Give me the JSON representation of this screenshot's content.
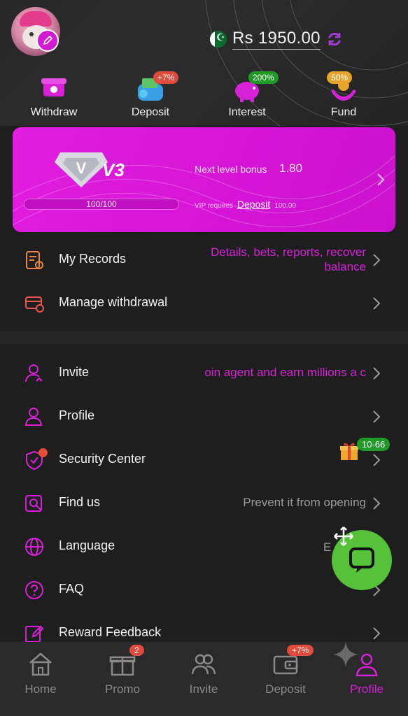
{
  "header": {
    "balance": "Rs 1950.00"
  },
  "quick_actions": [
    {
      "label": "Withdraw",
      "badge": ""
    },
    {
      "label": "Deposit",
      "badge": "+7%"
    },
    {
      "label": "Interest",
      "badge": "200%"
    },
    {
      "label": "Fund",
      "badge": "50%"
    }
  ],
  "vip": {
    "level": "V3",
    "progress_text": "100/100",
    "progress_fraction": 1.0,
    "next_level_label": "Next level bonus",
    "next_level_value": "1.80",
    "requires_label": "VIP requires",
    "requires_link": "Deposit",
    "requires_value": "100.00"
  },
  "records": [
    {
      "label": "My Records",
      "detail_line1": "Details, bets, reports, recover",
      "detail_line2": "balance"
    },
    {
      "label": "Manage withdrawal",
      "detail": ""
    }
  ],
  "menu": [
    {
      "label": "Invite",
      "detail": "oin agent and earn millions a c"
    },
    {
      "label": "Profile",
      "detail": ""
    },
    {
      "label": "Security Center",
      "detail": "",
      "badge": "10-66"
    },
    {
      "label": "Find us",
      "detail": "Prevent it from opening"
    },
    {
      "label": "Language",
      "detail": "E"
    },
    {
      "label": "FAQ",
      "detail": ""
    },
    {
      "label": "Reward Feedback",
      "detail": ""
    }
  ],
  "tabbar": [
    {
      "label": "Home",
      "badge": ""
    },
    {
      "label": "Promo",
      "badge": "2"
    },
    {
      "label": "Invite",
      "badge": ""
    },
    {
      "label": "Deposit",
      "badge": "+7%"
    },
    {
      "label": "Profile",
      "badge": "",
      "active": true
    }
  ],
  "colors": {
    "accent": "#d621d6",
    "background": "#1e1e1e",
    "fab": "#55c23a"
  }
}
